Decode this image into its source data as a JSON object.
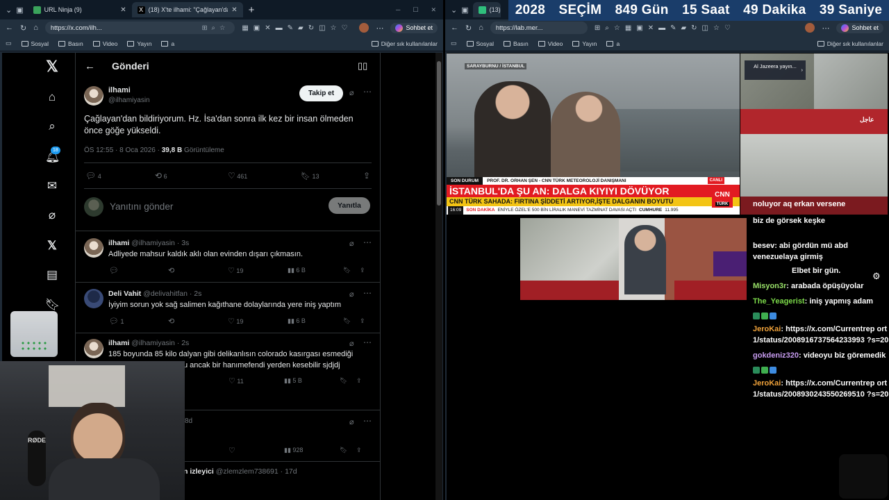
{
  "left_browser": {
    "tabs": [
      {
        "label": "URL Ninja (9)",
        "active": false
      },
      {
        "label": "(18) X'te ilhami: \"Çağlayan'dan bil…",
        "active": true
      }
    ],
    "new_tab": "+",
    "url": "https://x.com/ilh...",
    "sohbet_label": "Sohbet et",
    "bookmarks": [
      "Sosyal",
      "Basın",
      "Video",
      "Yayın",
      "a"
    ],
    "other_bookmarks": "Diğer sık kullanılanlar"
  },
  "right_browser": {
    "tab_label": "(13)",
    "url": "https://lab.mer...",
    "sohbet_label": "Sohbet et",
    "bookmarks": [
      "Sosyal",
      "Basın",
      "Video",
      "Yayın",
      "a"
    ],
    "other_bookmarks": "Diğer sık kullanılanlar"
  },
  "x": {
    "header_title": "Gönderi",
    "notif_badge": "18",
    "main_post": {
      "name": "ilhami",
      "handle": "@ilhamiyasin",
      "follow_label": "Takip et",
      "text": "Çağlayan'dan bildiriyorum. Hz. İsa'dan sonra ilk kez bir insan ölmeden önce göğe yükseldi.",
      "timestamp": "ÖS 12:55 · 8 Oca 2026 · ",
      "views": "39,8 B",
      "views_label": " Görüntüleme",
      "replies": "4",
      "reposts": "6",
      "likes": "461",
      "bookmarks": "13"
    },
    "reply_box": {
      "placeholder": "Yanıtını gönder",
      "button": "Yanıtla"
    },
    "replies": [
      {
        "name": "ilhami",
        "handle": "@ilhamiyasin · 3s",
        "text": "Adliyede mahsur kaldık aklı olan evinden dışarı çıkmasın.",
        "replies": "",
        "likes": "19",
        "views": "6 B"
      },
      {
        "name": "Deli Vahit",
        "handle": "@delivahitfan · 2s",
        "text": "İyiyim sorun yok sağ salimen kağıthane dolaylarında yere iniş yaptım",
        "replies": "1",
        "likes": "19",
        "views": "6 B"
      },
      {
        "name": "ilhami",
        "handle": "@ilhamiyasin · 2s",
        "text": "185 boyunda 85 kilo dalyan gibi delikanlısın colorado kasırgası esmediği",
        "text2": "u ancak bir hanımefendi yerden kesebilir sjdjdj",
        "replies": "",
        "likes": "11",
        "views": "5 B"
      },
      {
        "handle": "8d",
        "likes": "",
        "views": "928"
      },
      {
        "name": "n izleyici",
        "handle": "@zlemzlem738691 · 17d"
      }
    ]
  },
  "stream": {
    "countdown": [
      "2028",
      "SEÇİM",
      "849 Gün",
      "15 Saat",
      "49 Dakika",
      "39 Saniye"
    ],
    "tv": {
      "location": "SARAYBURNU / İSTANBUL",
      "son_durum": "SON DURUM",
      "guest": "PROF. DR. ORHAN ŞEN - CNN TÜRK METEOROLOJİ DANIŞMANI",
      "headline": "İSTANBUL'DA ŞU AN: DALGA KIYIYI DÖVÜYOR",
      "subline": "CNN TÜRK SAHADA: FIRTINA ŞİDDETİ ARTIYOR,İŞTE DALGANIN BOYUTU",
      "canli": "CANLI",
      "brand": "CNN",
      "brand2": "TÜRK",
      "ticker_time": "16:09",
      "ticker_tag": "SON DAKİKA",
      "ticker_text": "ENİYLE ÖZEL'E 500 BİN LİRALIK MANEVİ TAZMİNAT DAVASI AÇTI",
      "ticker_market": "CUMHURE",
      "ticker_value": "11.995"
    },
    "aj_label": "Al Jazeera yayın...",
    "aj_tag": "عاجل",
    "chat": [
      {
        "user": "",
        "text": "noluyor aq erkan versene",
        "color": "#ffffff"
      },
      {
        "user": "",
        "text": "biz de görsek keşke",
        "color": "#ffffff"
      },
      {
        "user": "besev",
        "text": "abi gördün mü abd venezuelaya girmiş",
        "color": "#ffffff"
      },
      {
        "user": "",
        "text": "Elbet bir gün.",
        "color": "#ffffff"
      },
      {
        "user": "Misyon3r",
        "text": "arabada öpüşüyolar",
        "color": "#9be36a"
      },
      {
        "user": "The_Yeagerist",
        "text": "iniş yapmış adam",
        "color": "#7ddb4a"
      },
      {
        "user": "JeroKai",
        "text": "https://x.com/Currentrep ort1/status/2008916737564233993 ?s=20",
        "color": "#f0a23a"
      },
      {
        "user": "gokdeniz320",
        "text": "videoyu biz göremedik",
        "color": "#c79cf0"
      },
      {
        "user": "JeroKai",
        "text": "https://x.com/Currentrep ort1/status/2008930243550269510 ?s=20",
        "color": "#f0a23a"
      }
    ],
    "webcam_mic": "RØDE"
  }
}
